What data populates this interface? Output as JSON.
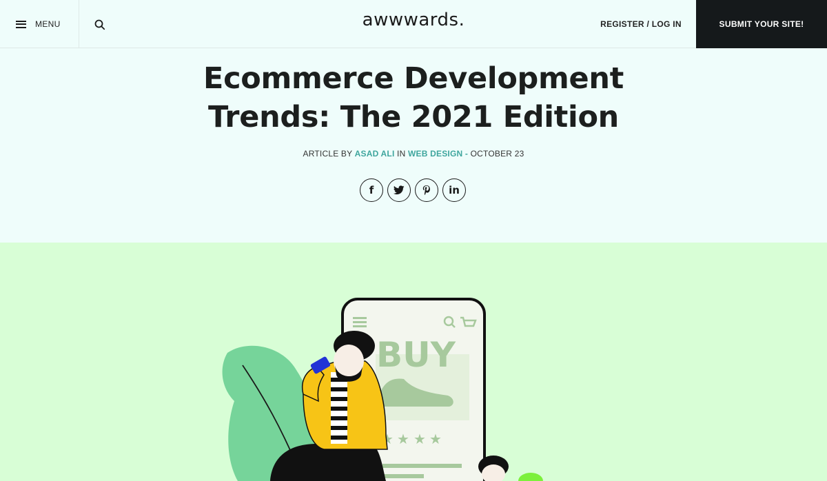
{
  "header": {
    "menu_label": "MENU",
    "logo_text": "awwwards.",
    "register_label": "REGISTER / LOG IN",
    "submit_label": "SUBMIT YOUR SITE!"
  },
  "article": {
    "title_line1": "Ecommerce Development",
    "title_line2": "Trends: The 2021 Edition",
    "meta_prefix": "ARTICLE BY",
    "author": "ASAD ALI",
    "meta_in": "IN",
    "category": "WEB DESIGN",
    "meta_sep": "-",
    "date": "OCTOBER 23"
  },
  "share": {
    "facebook": "f",
    "pinterest": "𝓅",
    "linkedin": "in"
  },
  "hero": {
    "phone_text": "BUY",
    "background_color": "#d8fed6",
    "accent_leaf": "#76d49a",
    "jacket_color": "#f7c416",
    "phone_color": "#2233d6"
  },
  "icons": [
    "menu-icon",
    "search-icon",
    "facebook-icon",
    "twitter-icon",
    "pinterest-icon",
    "linkedin-icon",
    "cart-icon"
  ]
}
